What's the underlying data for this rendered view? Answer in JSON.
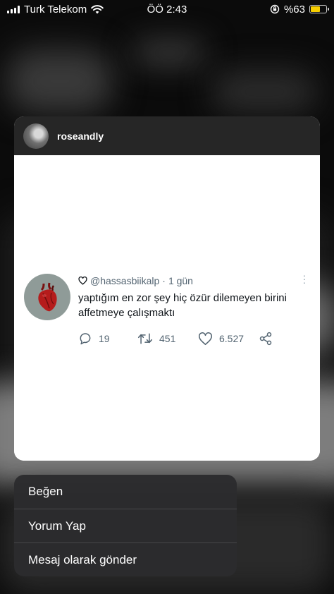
{
  "status_bar": {
    "carrier": "Turk Telekom",
    "time": "ÖÖ 2:43",
    "battery": "%63",
    "battery_level": 0.63,
    "battery_color": "#f7ce00"
  },
  "post": {
    "username": "roseandly",
    "tweet": {
      "handle": "@hassasbiikalp",
      "separator": "·",
      "age": "1 gün",
      "text": "yaptığım en zor şey hiç özür dilemeyen birini affetmeye çalışmaktı",
      "replies": "19",
      "retweets": "451",
      "likes": "6.527"
    }
  },
  "menu": {
    "items": [
      {
        "label": "Beğen"
      },
      {
        "label": "Yorum Yap"
      },
      {
        "label": "Mesaj olarak gönder"
      }
    ]
  },
  "icons": {
    "heart_outline": "heart-outline-icon",
    "reply": "reply-bubble-icon",
    "retweet": "retweet-icon",
    "like": "like-heart-icon",
    "share": "share-icon",
    "more": "more-dots-icon",
    "wifi": "wifi-icon",
    "signal": "cellular-signal-icon",
    "orientation_lock": "orientation-lock-icon",
    "battery": "battery-icon"
  }
}
